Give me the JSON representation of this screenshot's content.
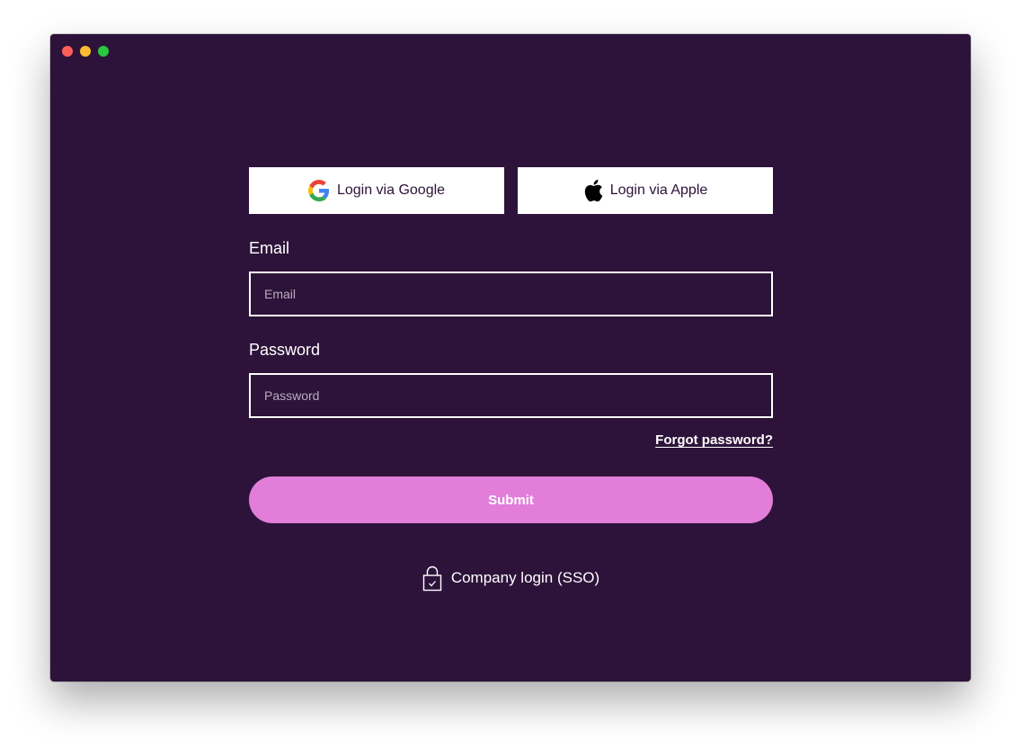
{
  "window": {
    "buttons": [
      "close",
      "minimize",
      "maximize"
    ]
  },
  "social": {
    "google_label": "Login via Google",
    "google_icon": "google-icon",
    "apple_label": "Login via Apple",
    "apple_icon": "apple-icon"
  },
  "email": {
    "label": "Email",
    "placeholder": "Email",
    "value": ""
  },
  "password": {
    "label": "Password",
    "placeholder": "Password",
    "value": ""
  },
  "forgot_password": "Forgot password?",
  "submit_label": "Submit",
  "sso": {
    "label": "Company login (SSO)",
    "icon": "lock-icon"
  },
  "colors": {
    "background": "#2d133a",
    "accent": "#e27dd9",
    "button_bg": "#ffffff",
    "text": "#ffffff"
  }
}
